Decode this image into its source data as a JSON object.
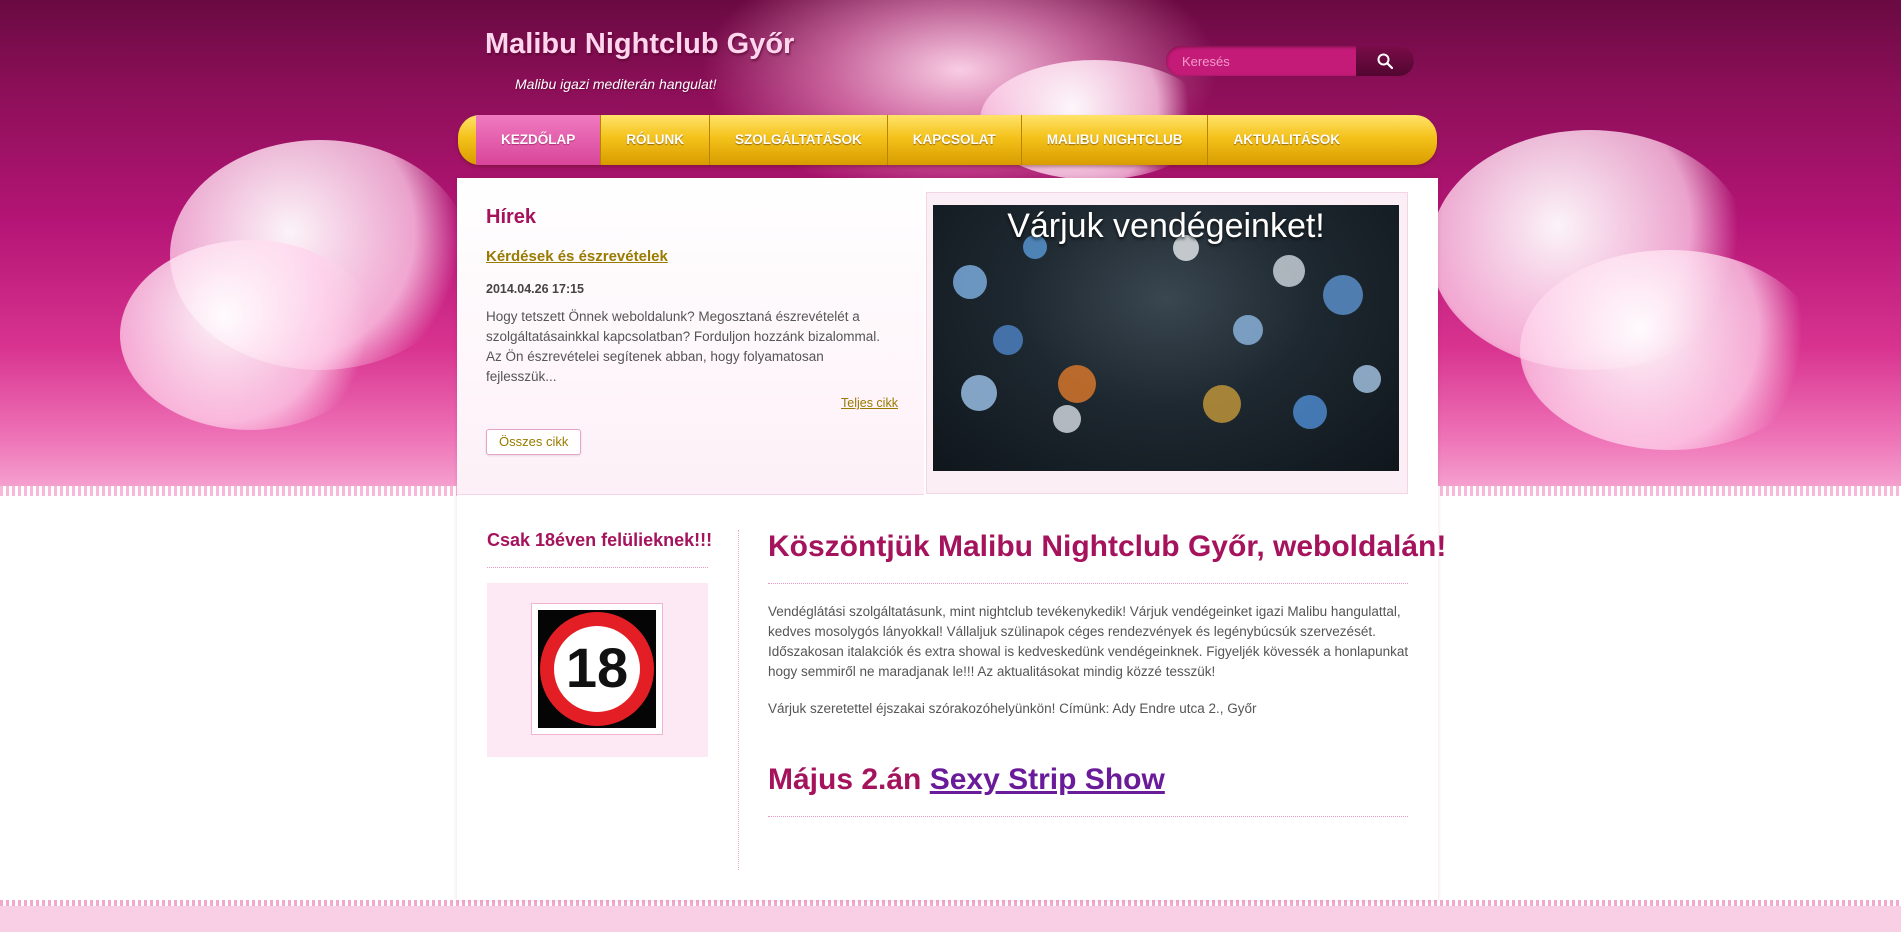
{
  "header": {
    "site_title": "Malibu Nightclub Győr",
    "tagline": "Malibu igazi mediterán hangulat!"
  },
  "search": {
    "placeholder": "Keresés",
    "icon": "search-icon"
  },
  "nav": {
    "items": [
      {
        "label": "KEZDŐLAP",
        "active": true
      },
      {
        "label": "RÓLUNK"
      },
      {
        "label": "SZOLGÁLTATÁSOK"
      },
      {
        "label": "KAPCSOLAT"
      },
      {
        "label": "MALIBU NIGHTCLUB"
      },
      {
        "label": "AKTUALITÁSOK"
      }
    ]
  },
  "news": {
    "heading": "Hírek",
    "article_title": "Kérdések és észrevételek",
    "date": "2014.04.26 17:15",
    "excerpt": "Hogy tetszett Önnek weboldalunk? Megosztaná észrevételét a szolgáltatásainkkal kapcsolatban? Forduljon hozzánk bizalommal. Az Ön észrevételei segítenek abban, hogy folyamatosan fejlesszük...",
    "more_link": "Teljes cikk",
    "all_button": "Összes cikk"
  },
  "banner": {
    "caption": "Várjuk vendégeinket!"
  },
  "sidebar": {
    "title": "Csak 18éven felülieknek!!!",
    "age_sign": "18"
  },
  "main": {
    "title": "Köszöntjük Malibu Nightclub Győr, weboldalán!",
    "paragraph1": "Vendéglátási szolgáltatásunk, mint nightclub tevékenykedik! Várjuk vendégeinket igazi Malibu hangulattal, kedves mosolygós lányokkal! Vállaljuk szülinapok céges rendezvények és legénybúcsúk szervezését. Időszakosan italakciók és extra showal is kedveskedünk vendégeinknek. Figyeljék kövessék a honlapunkat hogy semmiről ne maradjanak le!!! Az aktualitásokat mindig közzé tesszük!",
    "paragraph2": "Várjuk szeretettel éjszakai szórakozóhelyünkön! Címünk: Ady Endre utca 2., Győr",
    "event_prefix": "Május 2.án",
    "event_link": "Sexy Strip Show"
  },
  "colors": {
    "brand_pink": "#a5135d",
    "nav_gold": "#f4c21a",
    "link_gold": "#9a7a00",
    "event_link": "#6a1b9a"
  }
}
